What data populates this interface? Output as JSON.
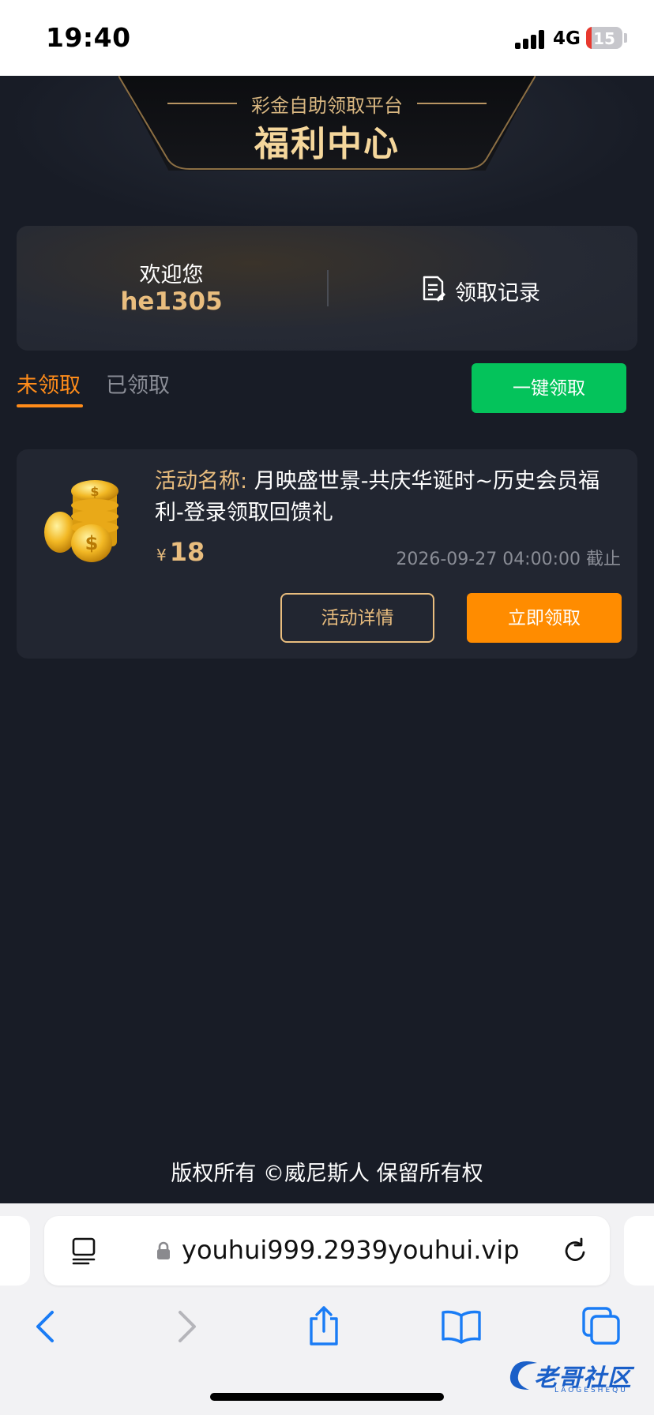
{
  "status_bar": {
    "time": "19:40",
    "network": "4G",
    "battery": "15"
  },
  "header": {
    "subtitle": "彩金自助领取平台",
    "title": "福利中心"
  },
  "welcome": {
    "label": "欢迎您",
    "username": "he1305",
    "records_label": "领取记录"
  },
  "tabs": [
    {
      "label": "未领取",
      "active": true
    },
    {
      "label": "已领取",
      "active": false
    }
  ],
  "one_click_label": "一键领取",
  "activities": [
    {
      "name_label": "活动名称:",
      "name": "月映盛世景-共庆华诞时~历史会员福利-登录领取回馈礼",
      "currency": "¥",
      "amount": "18",
      "deadline": "2026-09-27 04:00:00 截止",
      "detail_label": "活动详情",
      "claim_label": "立即领取"
    }
  ],
  "footer": {
    "copyright": "版权所有 ©威尼斯人 保留所有权"
  },
  "browser": {
    "url": "youhui999.2939youhui.vip"
  },
  "watermark": {
    "text": "老哥社区",
    "sub": "LAOGESHEQU"
  },
  "colors": {
    "accent_orange": "#ff8c1a",
    "green": "#04c35b",
    "gold": "#e9bd7e",
    "background": "#181c26"
  }
}
